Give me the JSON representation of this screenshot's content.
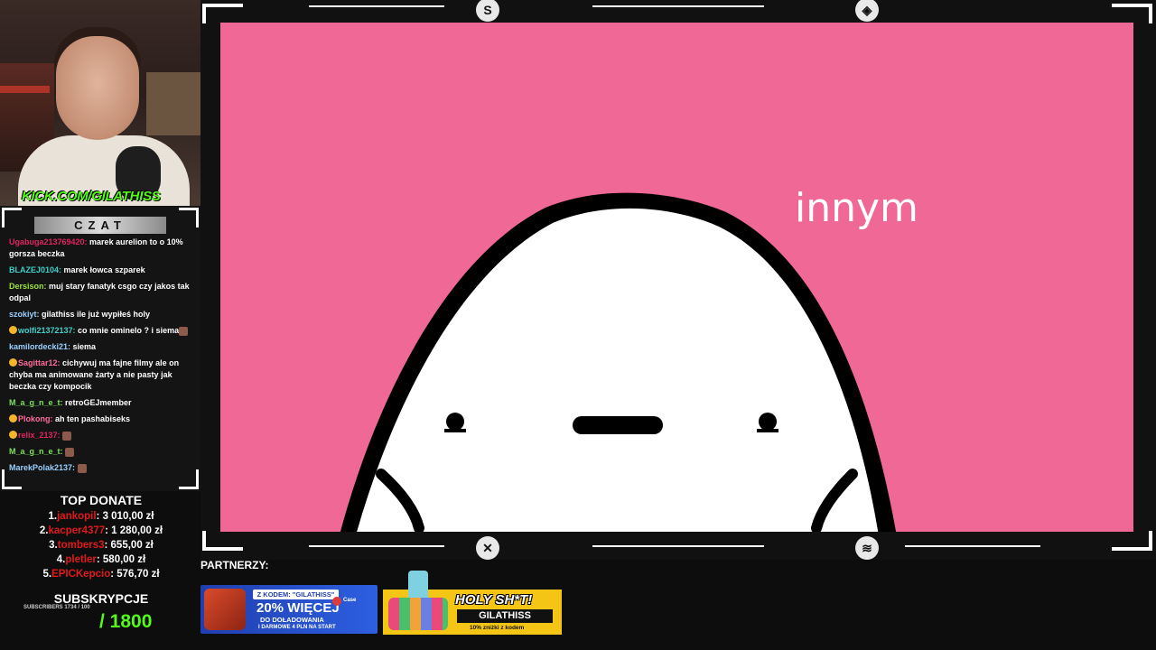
{
  "webcam": {
    "overlay_url": "KICK.COM/GILATHISS"
  },
  "chat": {
    "title": "CZAT",
    "messages": [
      {
        "user": "Ugabuga213769420:",
        "text": " marek aurelion to o 10% gorsza beczka",
        "color": "#e0245e",
        "badge": false,
        "emote": false
      },
      {
        "user": "BLAZEJ0104:",
        "text": " marek łowca szparek",
        "color": "#3fd0c9",
        "badge": false,
        "emote": false
      },
      {
        "user": "Dersison:",
        "text": " muj stary fanatyk csgo czy jakos tak odpal",
        "color": "#9be33a",
        "badge": false,
        "emote": false
      },
      {
        "user": "szokiyt:",
        "text": " gilathiss ile już wypiłeś holy",
        "color": "#9ad0ff",
        "badge": false,
        "emote": false
      },
      {
        "user": "wolfi21372137:",
        "text": " co mnie ominelo ? i siema",
        "color": "#3fd0c9",
        "badge": true,
        "emote": true
      },
      {
        "user": "kamilordecki21:",
        "text": " siema",
        "color": "#9ad0ff",
        "badge": false,
        "emote": false
      },
      {
        "user": "Sagittar12:",
        "text": " cichywuj ma fajne filmy ale on chyba ma animowane żarty a nie pasty jak beczka czy kompocik",
        "color": "#ff6b9a",
        "badge": true,
        "emote": false
      },
      {
        "user": "M_a_g_n_e_t:",
        "text": " retroGEJmember",
        "color": "#7de35a",
        "badge": false,
        "emote": false
      },
      {
        "user": "Plokong:",
        "text": " ah ten pashabiseks",
        "color": "#ff6b9a",
        "badge": true,
        "emote": false
      },
      {
        "user": "relix_2137:",
        "text": " ",
        "color": "#e0245e",
        "badge": true,
        "emote": true
      },
      {
        "user": "M_a_g_n_e_t:",
        "text": " ",
        "color": "#7de35a",
        "badge": false,
        "emote": true
      },
      {
        "user": "MarekPolak2137:",
        "text": " ",
        "color": "#9ad0ff",
        "badge": false,
        "emote": true
      }
    ]
  },
  "donate": {
    "title": "TOP DONATE",
    "rows": [
      {
        "rank": "1.",
        "name": "jankopil",
        "amount": ": 3 010,00 zł"
      },
      {
        "rank": "2.",
        "name": "kacper4377",
        "amount": ": 1 280,00 zł"
      },
      {
        "rank": "3.",
        "name": "tombers3",
        "amount": ": 655,00 zł"
      },
      {
        "rank": "4.",
        "name": "pletler",
        "amount": ": 580,00 zł"
      },
      {
        "rank": "5.",
        "name": "EPICKepcio",
        "amount": ": 576,70 zł"
      }
    ]
  },
  "subs": {
    "title": "SUBSKRYPCJE",
    "small": "SUBSCRIBERS 1734 / 100",
    "goal": "/ 1800"
  },
  "video": {
    "caption": "innym"
  },
  "partners": {
    "label": "PARTNERZY:",
    "case": {
      "code": "Z KODEM: \"GILATHISS\"",
      "big": "20% WIĘCEJ",
      "sub1": "DO DOŁADOWANIA",
      "sub2": "I DARMOWE 4 PLN NA START",
      "brand": "Case"
    },
    "holy": {
      "title": "HOLY SH*T!",
      "code": "GILATHISS",
      "disclaimer": "10% zniżki z kodem"
    }
  }
}
